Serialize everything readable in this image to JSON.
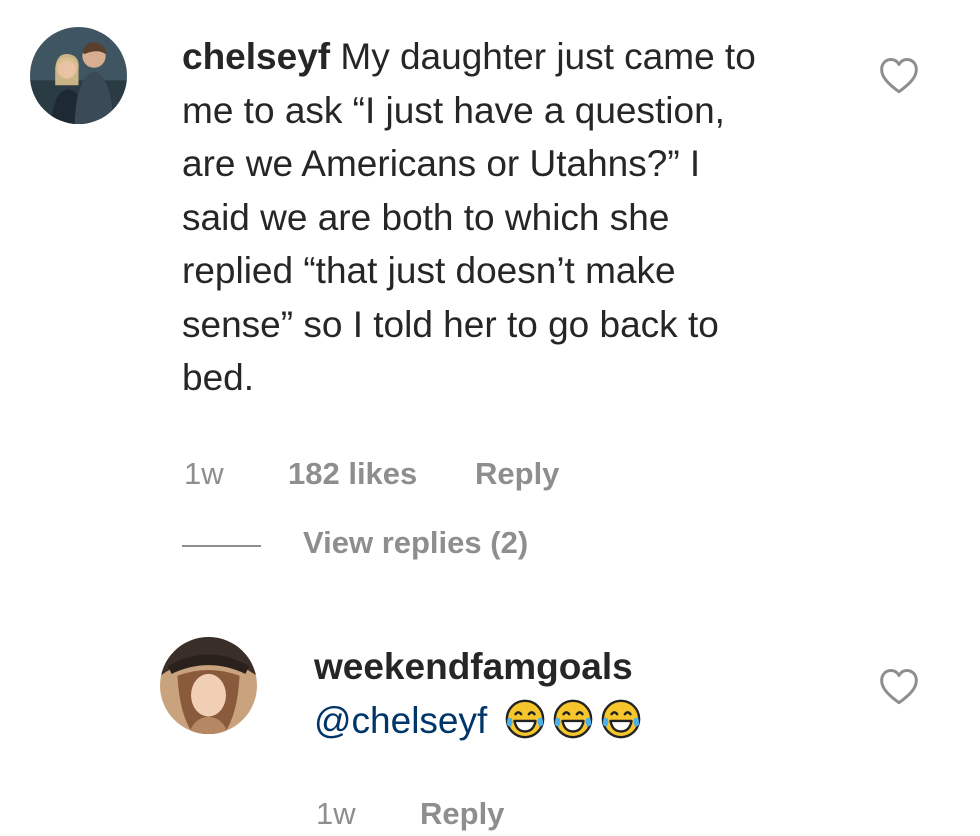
{
  "comments": [
    {
      "username": "chelseyf",
      "lines": [
        "My daughter just came to",
        "me to ask “I just have a question,",
        "are we Americans or Utahns?” I",
        "said we are both to which she",
        "replied “that just doesn’t make",
        "sense” so I told her to go back to",
        "bed."
      ],
      "time": "1w",
      "likes": "182 likes",
      "reply_label": "Reply",
      "view_replies": "View replies (2)"
    },
    {
      "username": "weekendfamgoals",
      "mention": "@chelseyf",
      "emoji": [
        "face-with-tears-of-joy",
        "face-with-tears-of-joy",
        "face-with-tears-of-joy"
      ],
      "time": "1w",
      "reply_label": "Reply"
    }
  ],
  "colors": {
    "text": "#262626",
    "meta": "#8e8e8e",
    "mention": "#003569",
    "heart_outline": "#8e8e8e"
  }
}
